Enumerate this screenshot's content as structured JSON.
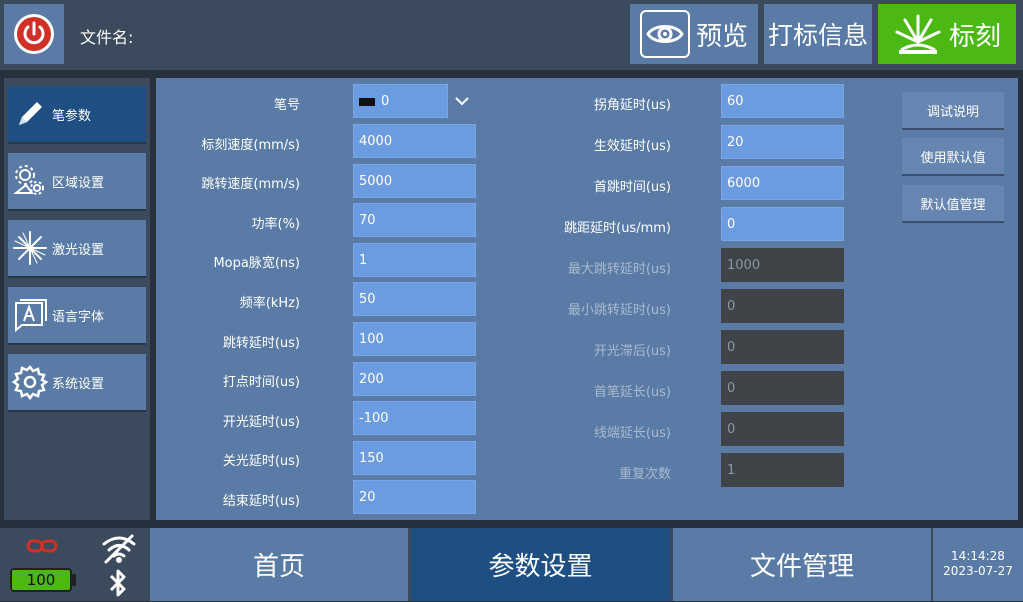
{
  "header": {
    "file_label": "文件名:",
    "preview_label": "预览",
    "info_label": "打标信息",
    "mark_label": "标刻"
  },
  "sidebar": {
    "items": [
      {
        "label": "笔参数",
        "icon": "pen-icon"
      },
      {
        "label": "区域设置",
        "icon": "gears-icon"
      },
      {
        "label": "激光设置",
        "icon": "laser-star-icon"
      },
      {
        "label": "语言字体",
        "icon": "font-icon"
      },
      {
        "label": "系统设置",
        "icon": "gear-icon"
      }
    ]
  },
  "params_left": [
    {
      "label": "笔号",
      "value": "0"
    },
    {
      "label": "标刻速度(mm/s)",
      "value": "4000"
    },
    {
      "label": "跳转速度(mm/s)",
      "value": "5000"
    },
    {
      "label": "功率(%)",
      "value": "70"
    },
    {
      "label": "Mopa脉宽(ns)",
      "value": "1"
    },
    {
      "label": "频率(kHz)",
      "value": "50"
    },
    {
      "label": "跳转延时(us)",
      "value": "100"
    },
    {
      "label": "打点时间(us)",
      "value": "200"
    },
    {
      "label": "开光延时(us)",
      "value": "-100"
    },
    {
      "label": "关光延时(us)",
      "value": "150"
    },
    {
      "label": "结束延时(us)",
      "value": "20"
    }
  ],
  "params_right": [
    {
      "label": "拐角延时(us)",
      "value": "60"
    },
    {
      "label": "生效延时(us)",
      "value": "20"
    },
    {
      "label": "首跳时间(us)",
      "value": "6000"
    },
    {
      "label": "跳距延时(us/mm)",
      "value": "0"
    },
    {
      "label": "最大跳转延时(us)",
      "value": "1000"
    },
    {
      "label": "最小跳转延时(us)",
      "value": "0"
    },
    {
      "label": "开光滞后(us)",
      "value": "0"
    },
    {
      "label": "首笔延长(us)",
      "value": "0"
    },
    {
      "label": "线端延长(us)",
      "value": "0"
    },
    {
      "label": "重复次数",
      "value": "1"
    }
  ],
  "side_buttons": {
    "debug_help": "调试说明",
    "use_default": "使用默认值",
    "default_mgmt": "默认值管理"
  },
  "status": {
    "battery": "100"
  },
  "bottom_nav": {
    "home": "首页",
    "params": "参数设置",
    "files": "文件管理"
  },
  "clock": {
    "time": "14:14:28",
    "date": "2023-07-27"
  },
  "colors": {
    "accent_green": "#4cb814",
    "active_blue": "#1f4f82",
    "field_blue": "#6b9be0",
    "power_red": "#d03025"
  }
}
